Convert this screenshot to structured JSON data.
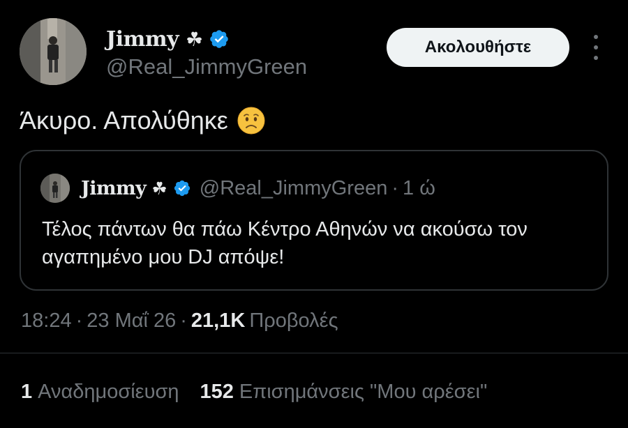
{
  "author": {
    "display_name": "Jimmy",
    "name_emoji": "☘",
    "handle": "@Real_JimmyGreen",
    "avatar_icon": "profile-photo",
    "verified_icon": "verified-badge-icon",
    "verified_color": "#1d9bf0"
  },
  "follow_button": {
    "label": "Ακολουθήστε"
  },
  "more_button": {
    "icon": "more-vertical-icon"
  },
  "tweet": {
    "text": "Άκυρο. Απολύθηκε",
    "emoji_icon": "worried-face-emoji"
  },
  "quoted_tweet": {
    "display_name": "Jimmy",
    "name_emoji": "☘",
    "handle": "@Real_JimmyGreen",
    "separator": "·",
    "time": "1 ώ",
    "text": "Τέλος πάντων θα πάω Κέντρο Αθηνών να ακούσω τον αγαπημένο μου DJ απόψε!"
  },
  "meta": {
    "time": "18:24",
    "separator": "·",
    "date": "23 Μαΐ 26",
    "views_count": "21,1K",
    "views_label": "Προβολές"
  },
  "stats": {
    "reposts_count": "1",
    "reposts_label": "Αναδημοσίευση",
    "likes_count": "152",
    "likes_label": "Επισημάνσεις \"Μου αρέσει\""
  },
  "colors": {
    "background": "#000000",
    "text_primary": "#e7e9ea",
    "text_secondary": "#71767b",
    "border": "#2f3336",
    "button_bg": "#eff3f4",
    "button_text": "#0f1419",
    "accent": "#1d9bf0"
  }
}
